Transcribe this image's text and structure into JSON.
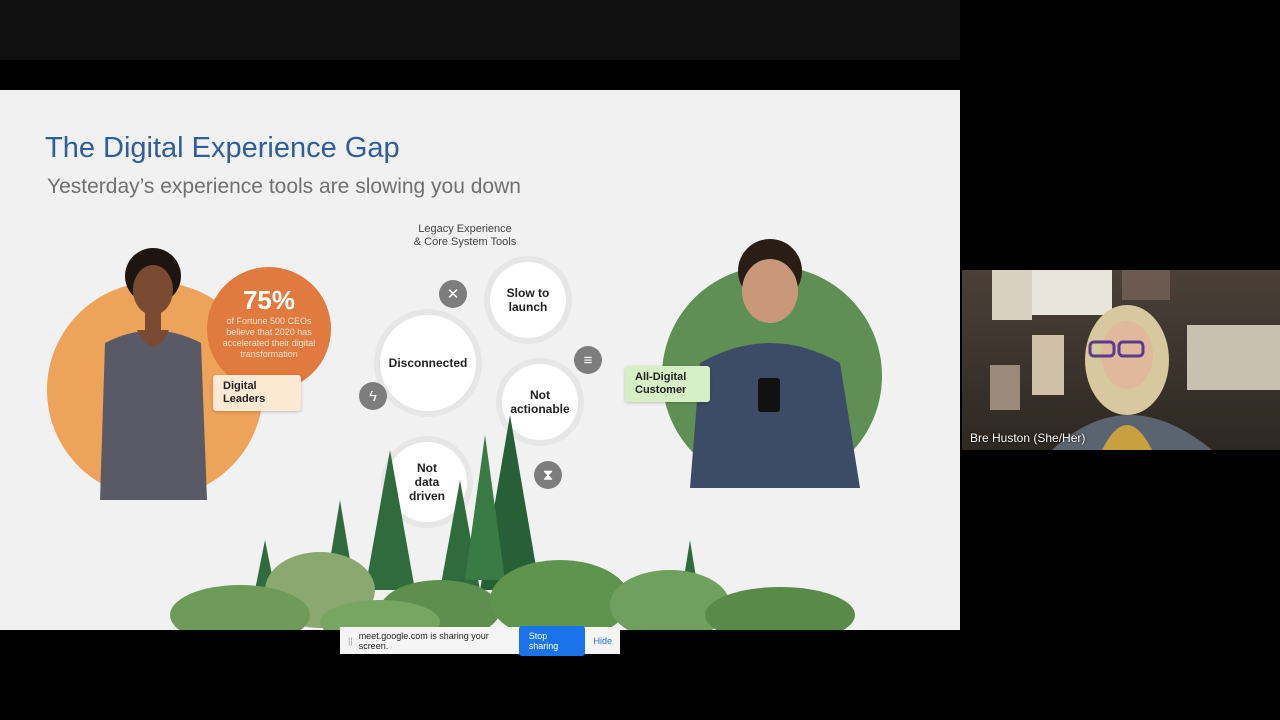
{
  "slide": {
    "title": "The Digital Experience Gap",
    "subtitle": "Yesterday’s experience tools are slowing you down",
    "legacy_label_1": "Legacy Experience",
    "legacy_label_2": "& Core System Tools",
    "bubbles": [
      "Disconnected",
      "Slow to launch",
      "Not actionable",
      "Not data driven"
    ],
    "stat": {
      "value": "75%",
      "text": "of Fortune 500 CEOs believe that 2020 has accelerated their digital transformation"
    },
    "left_tag": "Digital Leaders",
    "right_tag": "All-Digital Customer"
  },
  "share_bar": {
    "message": "meet.google.com is sharing your screen.",
    "stop": "Stop sharing",
    "hide": "Hide"
  },
  "participant": {
    "name": "Bre Huston (She/Her)"
  }
}
